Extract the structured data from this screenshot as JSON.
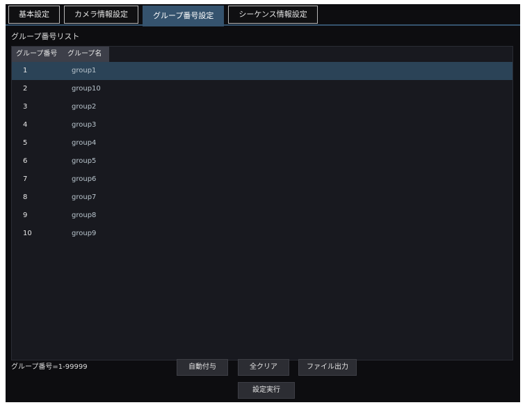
{
  "tabs": [
    {
      "label": "基本設定"
    },
    {
      "label": "カメラ情報設定"
    },
    {
      "label": "グループ番号設定"
    },
    {
      "label": "シーケンス情報設定"
    }
  ],
  "active_tab": 2,
  "list_title": "グループ番号リスト",
  "table": {
    "headers": [
      "グループ番号",
      "グループ名"
    ],
    "rows": [
      {
        "no": "1",
        "name": "group1"
      },
      {
        "no": "2",
        "name": "group10"
      },
      {
        "no": "3",
        "name": "group2"
      },
      {
        "no": "4",
        "name": "group3"
      },
      {
        "no": "5",
        "name": "group4"
      },
      {
        "no": "6",
        "name": "group5"
      },
      {
        "no": "7",
        "name": "group6"
      },
      {
        "no": "8",
        "name": "group7"
      },
      {
        "no": "9",
        "name": "group8"
      },
      {
        "no": "10",
        "name": "group9"
      }
    ],
    "selected_row": 0
  },
  "footer": {
    "range_text": "グループ番号=1-99999"
  },
  "buttons": {
    "auto_assign": "自動付与",
    "clear_all": "全クリア",
    "file_output": "ファイル出力",
    "apply": "設定実行"
  },
  "colors": {
    "background": "#0d0d10",
    "accent": "#35536e",
    "selected_row": "#2b4357",
    "table_header": "#3d3f49"
  }
}
